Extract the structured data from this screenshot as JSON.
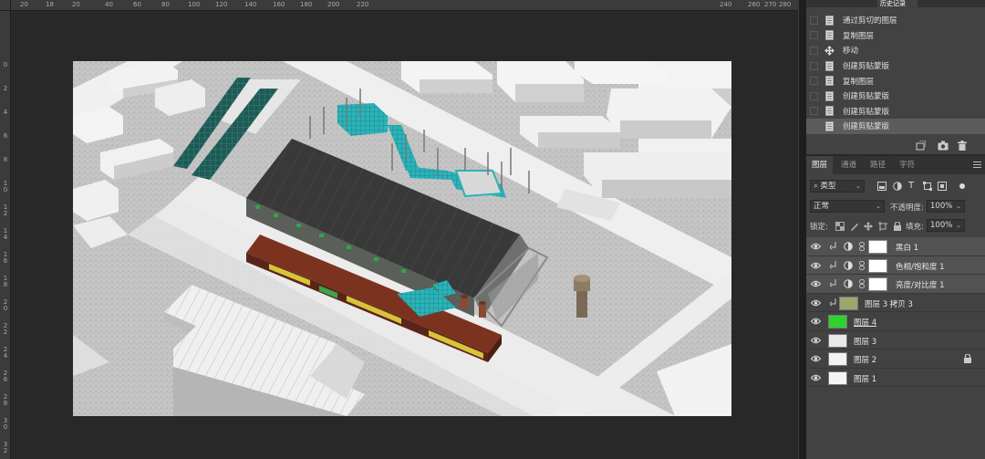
{
  "ruler": {
    "top_ticks": [
      "20",
      "18",
      "20",
      "40",
      "60",
      "80",
      "100",
      "120",
      "140",
      "160",
      "180",
      "200",
      "220",
      "240",
      "260",
      "270",
      "280"
    ],
    "left_ticks": [
      "0",
      "2",
      "4",
      "6",
      "8",
      "1 0",
      "1 2",
      "1 4",
      "1 6",
      "1 8",
      "2 0",
      "2 2",
      "2 4",
      "2 6",
      "2 8",
      "3 0",
      "3 2",
      "3 4"
    ]
  },
  "history": {
    "tabs": [
      "",
      "",
      "历史记录"
    ],
    "items": [
      {
        "label": "通过剪切的图层",
        "icon": "document-icon"
      },
      {
        "label": "复制图层",
        "icon": "document-icon"
      },
      {
        "label": "移动",
        "icon": "move-icon"
      },
      {
        "label": "创建剪贴蒙版",
        "icon": "document-icon"
      },
      {
        "label": "复制图层",
        "icon": "document-icon"
      },
      {
        "label": "创建剪贴蒙版",
        "icon": "document-icon"
      },
      {
        "label": "创建剪贴蒙版",
        "icon": "document-icon"
      },
      {
        "label": "创建剪贴蒙版",
        "icon": "document-icon",
        "selected": true
      }
    ]
  },
  "layers_panel": {
    "tabs": [
      "图层",
      "通道",
      "路径",
      "字符"
    ],
    "filter_kind": "类型",
    "blend_mode": "正常",
    "opacity_label": "不透明度:",
    "opacity_value": "100%",
    "lock_label": "锁定:",
    "fill_label": "填充:",
    "fill_value": "100%",
    "layers": [
      {
        "name": "黑白 1",
        "type": "adjustment",
        "clipped": true,
        "selected": true
      },
      {
        "name": "色相/饱和度 1",
        "type": "adjustment",
        "clipped": true,
        "selected": true
      },
      {
        "name": "亮度/对比度 1",
        "type": "adjustment",
        "clipped": true,
        "selected": true
      },
      {
        "name": "图层 3 拷贝 3",
        "type": "pixel",
        "clipped": true,
        "thumb_color": "#9aa86a"
      },
      {
        "name": "图层 4",
        "type": "pixel",
        "thumb_color": "#2fd12f",
        "underline": true
      },
      {
        "name": "图层 3",
        "type": "pixel",
        "thumb_color": "#e8e8e8"
      },
      {
        "name": "图层 2",
        "type": "pixel",
        "thumb_color": "#f2f2f2",
        "locked": true
      },
      {
        "name": "图层 1",
        "type": "pixel",
        "thumb_color": "#f5f5f5"
      }
    ]
  },
  "colors": {
    "app_bg": "#282828",
    "panel_bg": "#424242",
    "selected_row": "#525252",
    "accent_teal": "#2bb3b8",
    "roof_dark": "#3a3a3a",
    "brick_red": "#8a3a22"
  }
}
